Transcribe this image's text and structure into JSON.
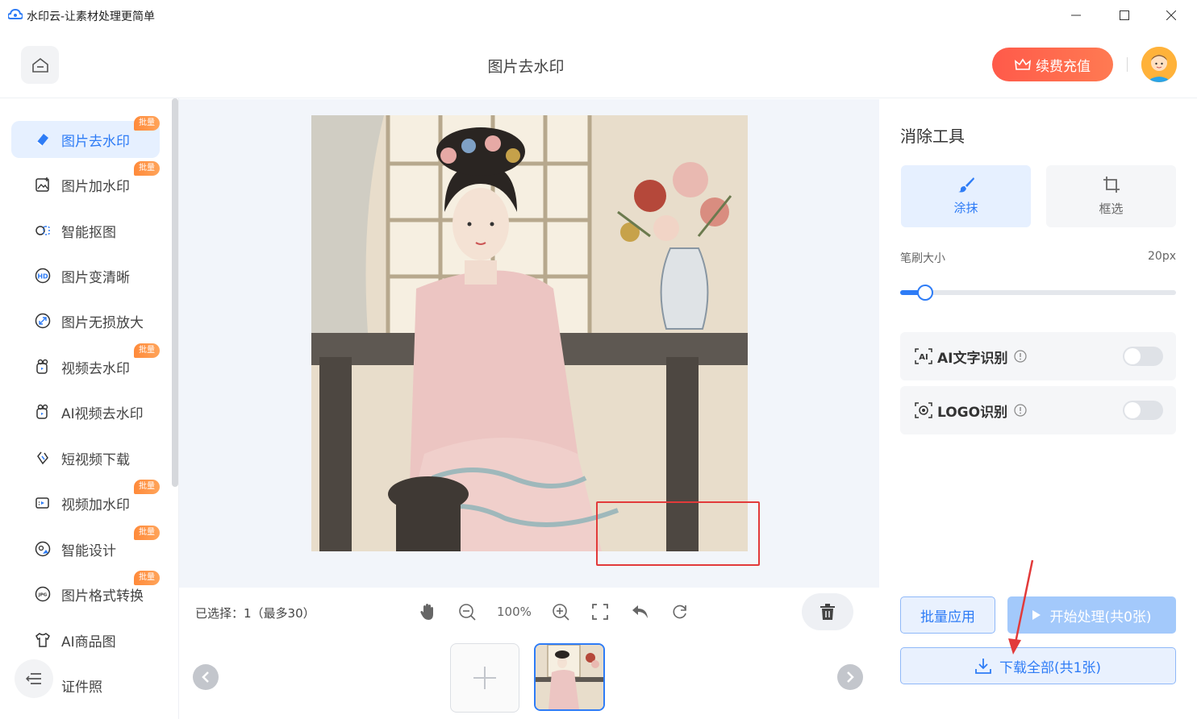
{
  "app": {
    "window_title": "水印云-让素材处理更简单",
    "page_title": "图片去水印",
    "vip_label": "续费充值"
  },
  "sidebar": {
    "items": [
      {
        "label": "图片去水印",
        "icon": "eraser-icon",
        "badge": "批量",
        "active": true
      },
      {
        "label": "图片加水印",
        "icon": "image-add-icon",
        "badge": "批量"
      },
      {
        "label": "智能抠图",
        "icon": "cutout-icon"
      },
      {
        "label": "图片变清晰",
        "icon": "hd-icon"
      },
      {
        "label": "图片无损放大",
        "icon": "expand-icon"
      },
      {
        "label": "视频去水印",
        "icon": "video-eraser-icon",
        "badge": "批量"
      },
      {
        "label": "AI视频去水印",
        "icon": "ai-video-icon"
      },
      {
        "label": "短视频下载",
        "icon": "link-icon"
      },
      {
        "label": "视频加水印",
        "icon": "video-add-icon",
        "badge": "批量"
      },
      {
        "label": "智能设计",
        "icon": "design-icon",
        "badge": "批量"
      },
      {
        "label": "图片格式转换",
        "icon": "jpg-icon",
        "badge": "批量"
      },
      {
        "label": "AI商品图",
        "icon": "shirt-icon"
      },
      {
        "label": "证件照",
        "icon": "id-photo-icon"
      }
    ]
  },
  "toolbar": {
    "selected_text": "已选择：1（最多30）",
    "zoom": "100%"
  },
  "panel": {
    "title": "消除工具",
    "mode_smear": "涂抹",
    "mode_box": "框选",
    "brush_label": "笔刷大小",
    "brush_value": "20px",
    "brush_fraction": 0.09,
    "ai_text_label": "AI文字识别",
    "logo_label": "LOGO识别",
    "batch_apply": "批量应用",
    "start_process": "开始处理(共0张)",
    "download_all": "下载全部(共1张)"
  },
  "colors": {
    "accent": "#2e7cf6",
    "vip": "#ff5a4a",
    "badge": "#ff8a3a"
  }
}
